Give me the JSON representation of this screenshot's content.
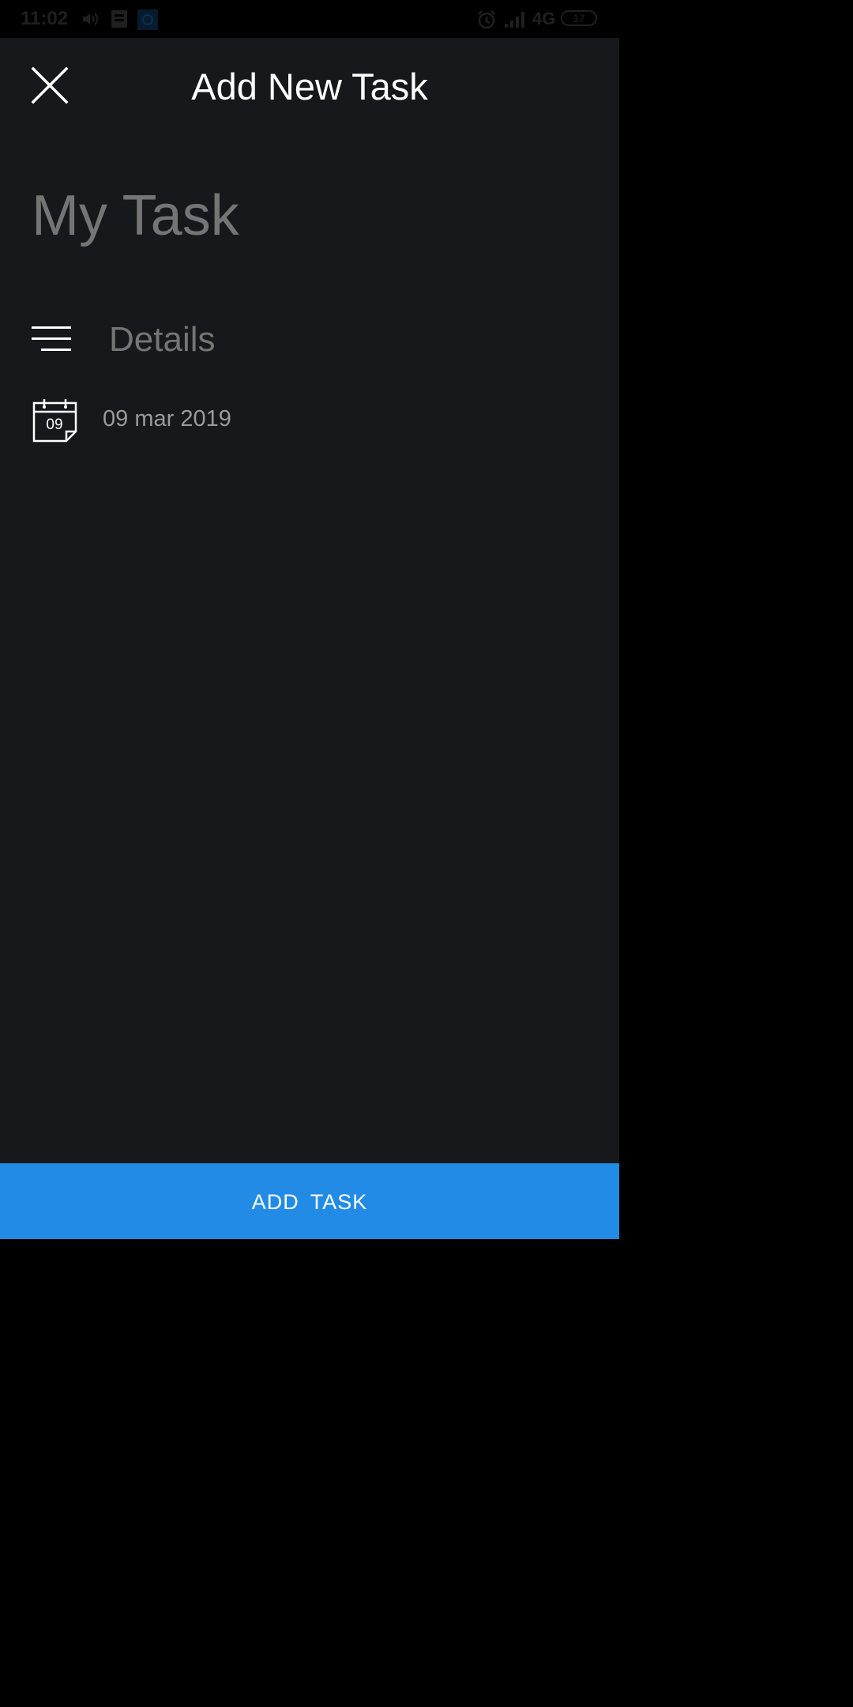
{
  "status_bar": {
    "time": "11:02",
    "network": "4G",
    "battery": "17",
    "icons": [
      "volume-icon",
      "sim-icon",
      "app-notification-icon",
      "alarm-icon",
      "signal-icon",
      "battery-icon"
    ]
  },
  "header": {
    "title": "Add New Task",
    "close_icon": "close-icon"
  },
  "form": {
    "task_title_placeholder": "My Task",
    "details_placeholder": "Details",
    "details_icon": "notes-lines-icon",
    "date": {
      "icon": "calendar-icon",
      "day": "09",
      "text": "09 mar 2019"
    }
  },
  "footer": {
    "add_task_label": "ADD TASK"
  },
  "colors": {
    "background": "#17181c",
    "accent": "#218be6",
    "muted_text": "#9c9c9c"
  }
}
